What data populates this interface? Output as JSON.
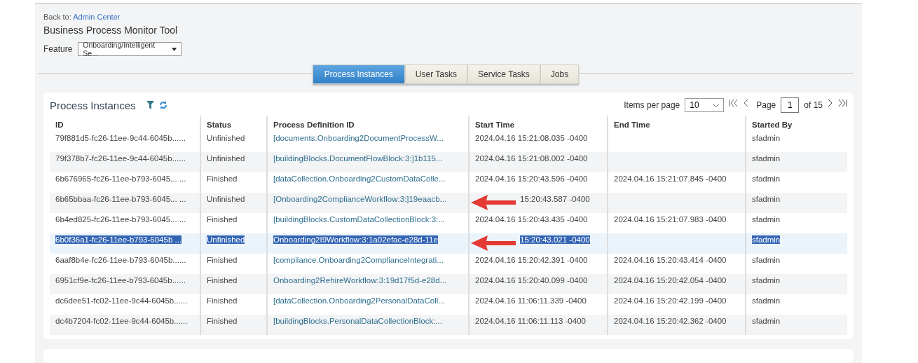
{
  "header": {
    "back_label": "Back to:",
    "back_link": "Admin Center",
    "title": "Business Process Monitor Tool",
    "feature_label": "Feature",
    "feature_value": "Onboarding/Intelligent Se..."
  },
  "tabs": [
    {
      "label": "Process Instances",
      "selected": true
    },
    {
      "label": "User Tasks",
      "selected": false
    },
    {
      "label": "Service Tasks",
      "selected": false
    },
    {
      "label": "Jobs",
      "selected": false
    }
  ],
  "panel": {
    "title": "Process Instances",
    "items_per_page_label": "Items per page",
    "items_per_page": "10",
    "page_label": "Page",
    "page": "1",
    "page_total": "of 15"
  },
  "table": {
    "columns": [
      "ID",
      "Status",
      "Process Definition ID",
      "Start Time",
      "End Time",
      "Started By"
    ],
    "rows": [
      {
        "cells": [
          "79f881d5-fc26-11ee-9c44-6045b......",
          "Unfinished",
          "[documents.Onboarding2DocumentProcessW...",
          "2024.04.16 15:21:08.035 -0400",
          "",
          "sfadmin"
        ],
        "selected": false,
        "arrow": false
      },
      {
        "cells": [
          "79f378b7-fc26-11ee-9c44-6045b......",
          "Unfinished",
          "[buildingBlocks.DocumentFlowBlock:3:]1b115...",
          "2024.04.16 15:21:08.002 -0400",
          "",
          "sfadmin"
        ],
        "selected": false,
        "arrow": false
      },
      {
        "cells": [
          "6b676965-fc26-11ee-b793-6045... ...",
          "Finished",
          "[dataCollection.Onboarding2CustomDataColle...",
          "2024.04.16 15:20:43.596 -0400",
          "2024.04.16 15:21:07.845 -0400",
          "sfadmin"
        ],
        "selected": false,
        "arrow": false
      },
      {
        "cells": [
          "6b65bbaa-fc26-11ee-b793-6045... ...",
          "Unfinished",
          "[Onboarding2ComplianceWorkflow:3:]19eaacb...",
          "15:20:43.587 -0400",
          "",
          "sfadmin"
        ],
        "selected": false,
        "arrow": true
      },
      {
        "cells": [
          "6b4ed825-fc26-11ee-b793-6045... ...",
          "Finished",
          "[buildingBlocks.CustomDataCollectionBlock:3:...",
          "2024.04.16 15:20:43.435 -0400",
          "2024.04.16 15:21:07.983 -0400",
          "sfadmin"
        ],
        "selected": false,
        "arrow": false
      },
      {
        "cells": [
          "6b0f36a1-fc26-11ee-b793-6045b   ...",
          "Unfinished",
          "Onboarding2I9Workflow:3:1a02efac-e28d-11e",
          "15:20:43.021 -0400",
          "",
          "sfadmin"
        ],
        "selected": true,
        "arrow": true
      },
      {
        "cells": [
          "6aaf8b4e-fc26-11ee-b793-6045b......",
          "Finished",
          "[compliance.Onboarding2ComplianceIntegrati...",
          "2024.04.16 15:20:42.391 -0400",
          "2024.04.16 15:20:43.414 -0400",
          "sfadmin"
        ],
        "selected": false,
        "arrow": false
      },
      {
        "cells": [
          "6951cf9e-fc26-11ee-b793-6045b......",
          "Finished",
          "Onboarding2RehireWorkflow:3:19d17f5d-e28d...",
          "2024.04.16 15:20:40.099 -0400",
          "2024.04.16 15:20:42.054 -0400",
          "sfadmin"
        ],
        "selected": false,
        "arrow": false
      },
      {
        "cells": [
          "dc6dee51-fc02-11ee-9c44-6045b......",
          "Finished",
          "[dataCollection.Onboarding2PersonalDataColl...",
          "2024.04.16 11:06:11.339 -0400",
          "2024.04.16 15:20:42.199 -0400",
          "sfadmin"
        ],
        "selected": false,
        "arrow": false
      },
      {
        "cells": [
          "dc4b7204-fc02-11ee-9c44-6045b......",
          "Finished",
          "[buildingBlocks.PersonalDataCollectionBlock:...",
          "2024.04.16 11:06:11.113 -0400",
          "2024.04.16 15:20:42.362 -0400",
          "sfadmin"
        ],
        "selected": false,
        "arrow": false
      }
    ]
  }
}
